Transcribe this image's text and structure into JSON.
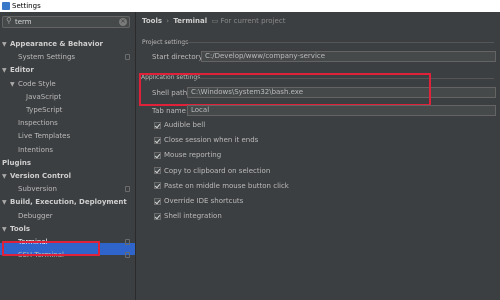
{
  "window": {
    "title": "Settings"
  },
  "search": {
    "value": "term"
  },
  "sidebar": {
    "items": [
      {
        "label": "Appearance & Behavior",
        "level": 0,
        "arrow": "▼",
        "bold": true
      },
      {
        "label": "System Settings",
        "level": 1,
        "arrow": "",
        "bold": false
      },
      {
        "label": "Editor",
        "level": 0,
        "arrow": "▼",
        "bold": true
      },
      {
        "label": "Code Style",
        "level": 1,
        "arrow": "▼",
        "bold": false
      },
      {
        "label": "JavaScript",
        "level": 2,
        "arrow": "",
        "bold": false
      },
      {
        "label": "TypeScript",
        "level": 2,
        "arrow": "",
        "bold": false
      },
      {
        "label": "Inspections",
        "level": 1,
        "arrow": "",
        "bold": false
      },
      {
        "label": "Live Templates",
        "level": 1,
        "arrow": "",
        "bold": false
      },
      {
        "label": "Intentions",
        "level": 1,
        "arrow": "",
        "bold": false
      },
      {
        "label": "Plugins",
        "level": 0,
        "arrow": "",
        "bold": true
      },
      {
        "label": "Version Control",
        "level": 0,
        "arrow": "▼",
        "bold": true
      },
      {
        "label": "Subversion",
        "level": 1,
        "arrow": "",
        "bold": false
      },
      {
        "label": "Build, Execution, Deployment",
        "level": 0,
        "arrow": "▼",
        "bold": true
      },
      {
        "label": "Debugger",
        "level": 1,
        "arrow": "",
        "bold": false
      },
      {
        "label": "Tools",
        "level": 0,
        "arrow": "▼",
        "bold": true
      },
      {
        "label": "Terminal",
        "level": 1,
        "arrow": "",
        "bold": false
      },
      {
        "label": "SSH Terminal",
        "level": 1,
        "arrow": "",
        "bold": false
      }
    ]
  },
  "breadcrumb": {
    "parent": "Tools",
    "separator": "›",
    "current": "Terminal",
    "project_note": "For current project"
  },
  "project_settings": {
    "label": "Project settings",
    "start_directory_label": "Start directory",
    "start_directory_value": "C:/Develop/www/company-service"
  },
  "app_settings": {
    "label": "Application settings",
    "shell_path_label": "Shell path",
    "shell_path_value": "C:\\Windows\\System32\\bash.exe",
    "tab_name_label": "Tab name",
    "tab_name_value": "Local",
    "checkboxes": [
      {
        "label": "Audible bell",
        "checked": true
      },
      {
        "label": "Close session when it ends",
        "checked": true
      },
      {
        "label": "Mouse reporting",
        "checked": true
      },
      {
        "label": "Copy to clipboard on selection",
        "checked": true
      },
      {
        "label": "Paste on middle mouse button click",
        "checked": true
      },
      {
        "label": "Override IDE shortcuts",
        "checked": true
      },
      {
        "label": "Shell integration",
        "checked": true
      }
    ]
  },
  "colors": {
    "background": "#3c3f41",
    "selection": "#2f65ca",
    "highlight": "#e0213a"
  }
}
